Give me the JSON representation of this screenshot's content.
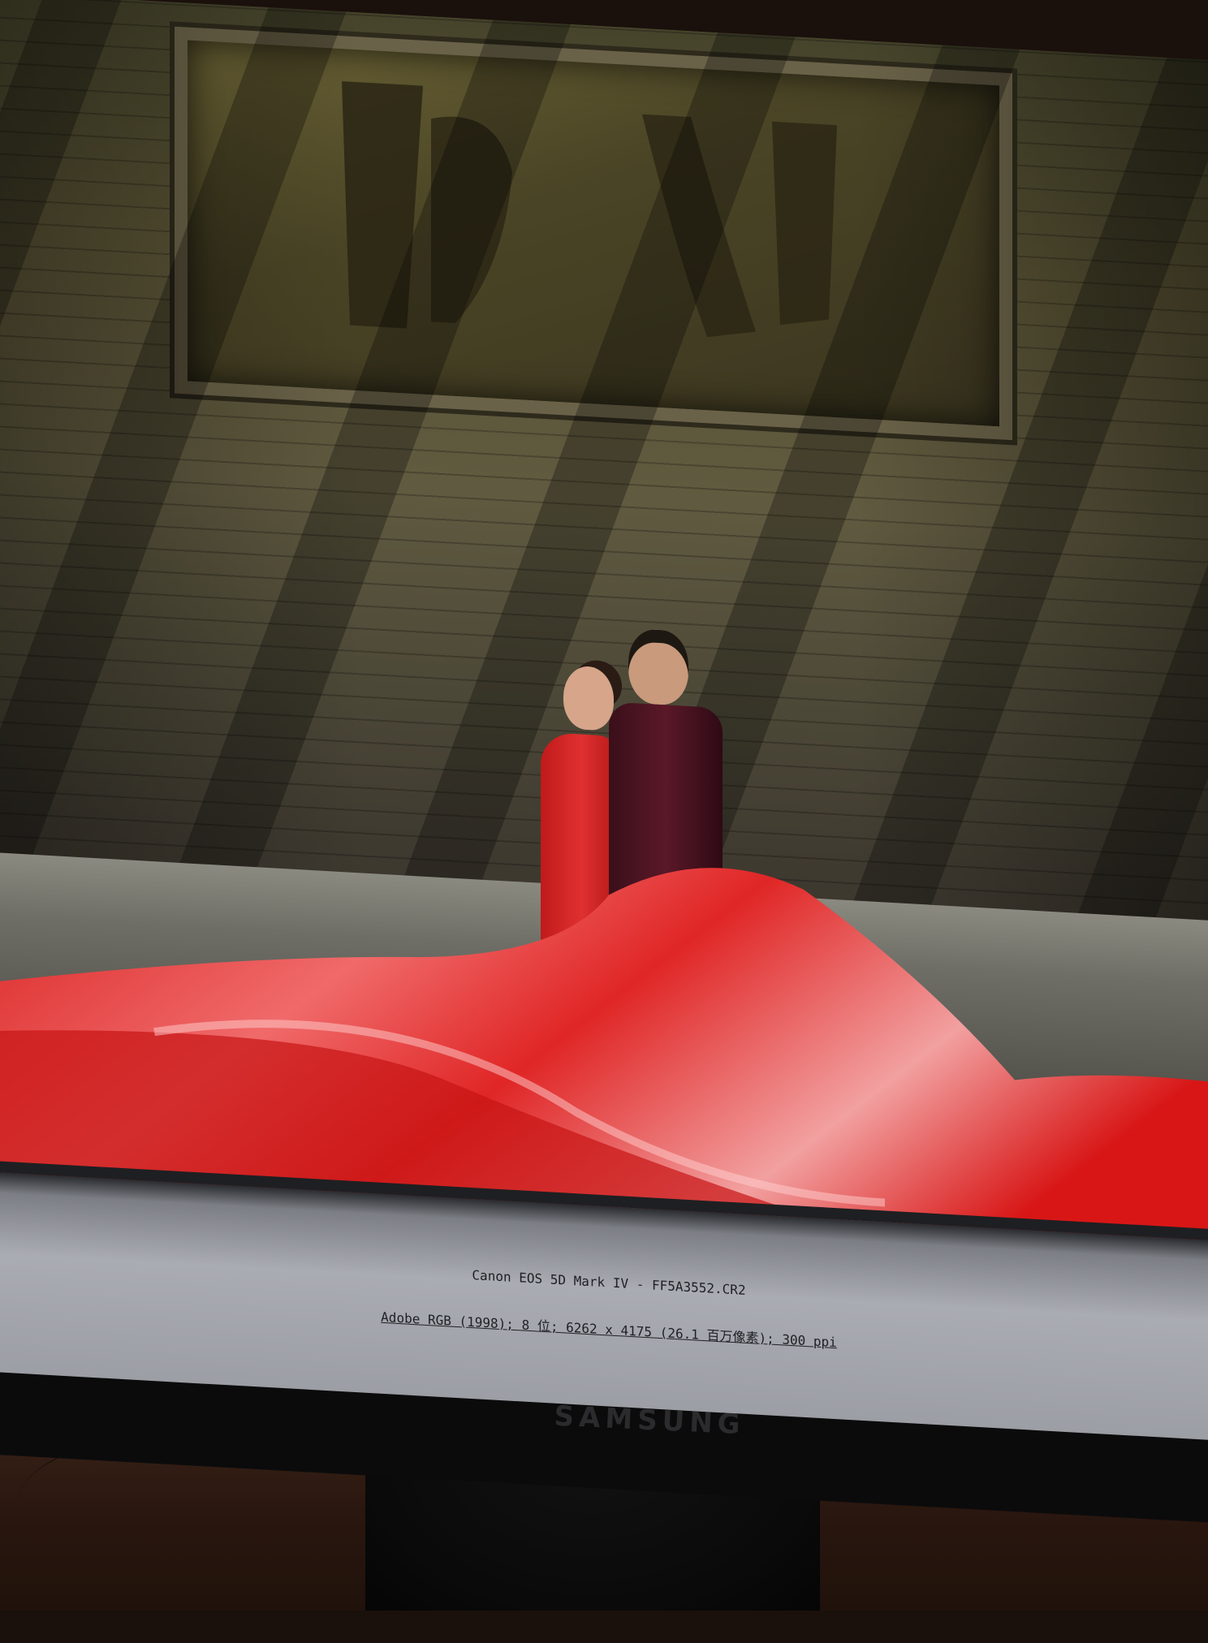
{
  "viewer": {
    "camera_and_file": "Canon EOS 5D Mark IV -  FF5A3552.CR2",
    "image_info": "Adobe RGB (1998); 8 位; 6262 x 4175 (26.1 百万像素); 300 ppi"
  },
  "monitor": {
    "brand": "SAMSUNG"
  },
  "colors": {
    "fabric": "#e02020",
    "status_bar": "#a9acb2"
  }
}
